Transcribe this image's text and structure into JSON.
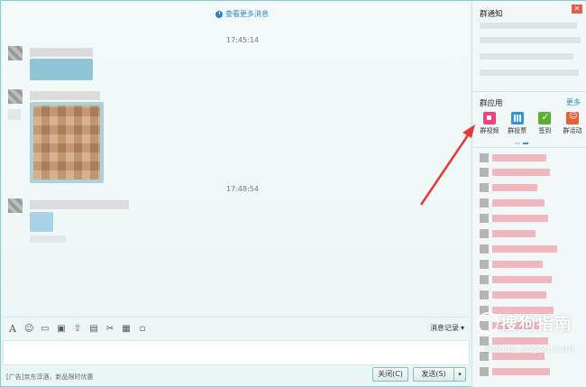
{
  "chat": {
    "more_messages": "查看更多消息",
    "timestamps": [
      "17:45:14",
      "17:48:54"
    ]
  },
  "toolbar": {
    "font_icon": "A",
    "emoji_icon": "☺",
    "history_label": "消息记录",
    "history_arrow": "▾"
  },
  "bottom": {
    "ad_text": "[广告]京东淳酒，新品限时优惠",
    "close_label": "关闭(C)",
    "send_label": "发送(S)",
    "send_dropdown": "▾"
  },
  "right_panel": {
    "notice_title": "群通知",
    "apps_title": "群应用",
    "more_label": "更多",
    "apps": [
      {
        "label": "群视频",
        "icon": "video-icon",
        "color": "#e9467b"
      },
      {
        "label": "群投票",
        "icon": "vote-icon",
        "color": "#2a97de"
      },
      {
        "label": "签到",
        "icon": "checkin-icon",
        "color": "#5fae2e"
      },
      {
        "label": "群活动",
        "icon": "event-icon",
        "color": "#e2603a"
      }
    ]
  },
  "watermark": {
    "cn": "搜狗指南",
    "en": "zhinan.sogou.com"
  },
  "colors": {
    "accent": "#2a86c9",
    "annotation_arrow": "#e53935"
  }
}
